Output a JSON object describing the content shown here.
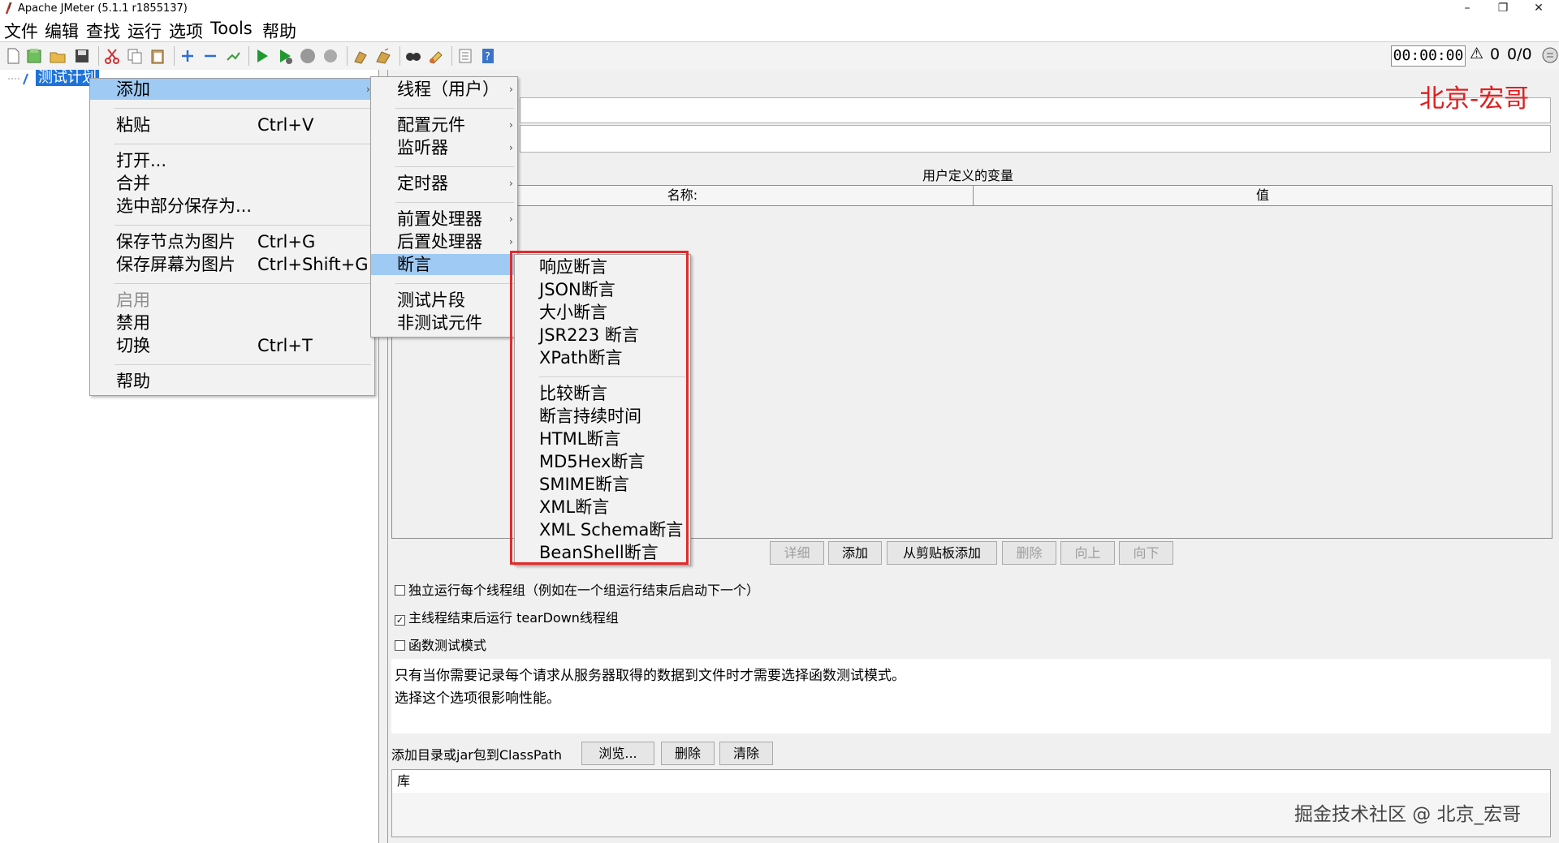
{
  "window": {
    "title": "Apache JMeter (5.1.1 r1855137)",
    "controls": [
      "–",
      "❐",
      "✕"
    ]
  },
  "menubar": [
    "文件",
    "编辑",
    "查找",
    "运行",
    "选项",
    "Tools",
    "帮助"
  ],
  "toolbar": {
    "icons": [
      "new-icon",
      "templates-icon",
      "open-icon",
      "save-icon",
      "cut-icon",
      "copy-icon",
      "paste-icon",
      "expand-icon",
      "collapse-icon",
      "toggle-icon",
      "start-icon",
      "start-no-pause-icon",
      "stop-icon",
      "shutdown-icon",
      "clear-icon",
      "clear-all-icon",
      "search-icon",
      "reset-search-icon",
      "function-helper-icon",
      "help-icon"
    ],
    "timer": "00:00:00",
    "warning_glyph": "⚠",
    "warning_count": "0",
    "thread_count": "0/0"
  },
  "tree": {
    "selected_item": "测试计划"
  },
  "right_panel": {
    "watermark_top": "北京-宏哥",
    "vars_title": "用户定义的变量",
    "col_name": "名称:",
    "col_value": "值",
    "buttons": {
      "detail": "详细",
      "add": "添加",
      "add_from_clipboard": "从剪贴板添加",
      "delete": "删除",
      "up": "向上",
      "down": "向下"
    },
    "checks": {
      "run_serially": "独立运行每个线程组（例如在一个组运行结束后启动下一个）",
      "teardown": "主线程结束后运行 tearDown线程组",
      "functional_mode": "函数测试模式"
    },
    "note_line1": "只有当你需要记录每个请求从服务器取得的数据到文件时才需要选择函数测试模式。",
    "note_line2": "选择这个选项很影响性能。",
    "classpath_label": "添加目录或jar包到ClassPath",
    "browse": "浏览...",
    "cp_delete": "删除",
    "cp_clear": "清除",
    "lib_header": "库",
    "watermark_bottom": "掘金技术社区 @ 北京_宏哥"
  },
  "context_menu": {
    "add": "添加",
    "paste": "粘贴",
    "paste_key": "Ctrl+V",
    "open": "打开...",
    "merge": "合并",
    "save_selection": "选中部分保存为...",
    "save_node_image": "保存节点为图片",
    "save_node_image_key": "Ctrl+G",
    "save_screen_image": "保存屏幕为图片",
    "save_screen_image_key": "Ctrl+Shift+G",
    "enable": "启用",
    "disable": "禁用",
    "toggle": "切换",
    "toggle_key": "Ctrl+T",
    "help": "帮助"
  },
  "add_submenu": {
    "threads": "线程（用户）",
    "config": "配置元件",
    "listener": "监听器",
    "timer": "定时器",
    "pre": "前置处理器",
    "post": "后置处理器",
    "assertions": "断言",
    "fragment": "测试片段",
    "non_test": "非测试元件"
  },
  "assertion_submenu": [
    "响应断言",
    "JSON断言",
    "大小断言",
    "JSR223 断言",
    "XPath断言",
    "比较断言",
    "断言持续时间",
    "HTML断言",
    "MD5Hex断言",
    "SMIME断言",
    "XML断言",
    "XML Schema断言",
    "BeanShell断言"
  ],
  "colors": {
    "highlight": "#9fcaf3",
    "selection": "#1e73d8",
    "annotation_red": "#e42a2a"
  }
}
